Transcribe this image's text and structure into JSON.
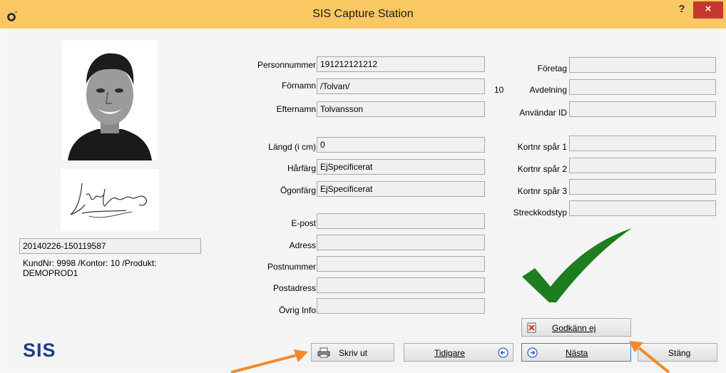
{
  "window": {
    "title": "SIS Capture Station",
    "help": "?",
    "close": "×"
  },
  "person": {
    "id_number": "20140226-150119587",
    "info_line1": "KundNr: 9998 /Kontor: 10 /Produkt:",
    "info_line2": "DEMOPROD1"
  },
  "labels": {
    "personnummer": "Personnummer",
    "fornamn": "Förnamn",
    "efternamn": "Efternamn",
    "langd": "Längd (i cm)",
    "harfarg": "Hårfärg",
    "ogonfarg": "Ögonfärg",
    "epost": "E-post",
    "adress": "Adress",
    "postnummer": "Postnummer",
    "postadress": "Postadress",
    "ovrig_info": "Övrig Info",
    "foretag": "Företag",
    "avdelning": "Avdelning",
    "avdelning_value": "10",
    "anvandar_id": "Användar ID",
    "kortnr1": "Kortnr spår 1",
    "kortnr2": "Kortnr spår 2",
    "kortnr3": "Kortnr spår 3",
    "streckkodstyp": "Streckkodstyp"
  },
  "values": {
    "personnummer": "191212121212",
    "fornamn": "/Tolvan/",
    "efternamn": "Tolvansson",
    "langd": "0",
    "harfarg": "EjSpecificerat",
    "ogonfarg": "EjSpecificerat",
    "epost": "",
    "adress": "",
    "postnummer": "",
    "postadress": "",
    "ovrig_info": "",
    "foretag": "",
    "avdelning": "",
    "anvandar_id": "",
    "kortnr1": "",
    "kortnr2": "",
    "kortnr3": "",
    "streckkodstyp": ""
  },
  "buttons": {
    "godkann_ej": "Godkänn ej",
    "skriv_ut": "Skriv ut",
    "tidigare": "Tidigare",
    "nasta": "Nästa",
    "stang": "Stäng"
  },
  "brand": {
    "logo": "SIS"
  },
  "colors": {
    "titlebar": "#fac862",
    "close": "#c7372f",
    "check": "#1e7d1e",
    "arrow": "#f0892a",
    "logo": "#1e3a8a"
  },
  "icons": [
    "app-logo-icon",
    "printer-icon",
    "arrow-left-icon",
    "arrow-right-icon",
    "reject-document-icon",
    "checkmark-icon",
    "pointer-arrow-icon"
  ]
}
